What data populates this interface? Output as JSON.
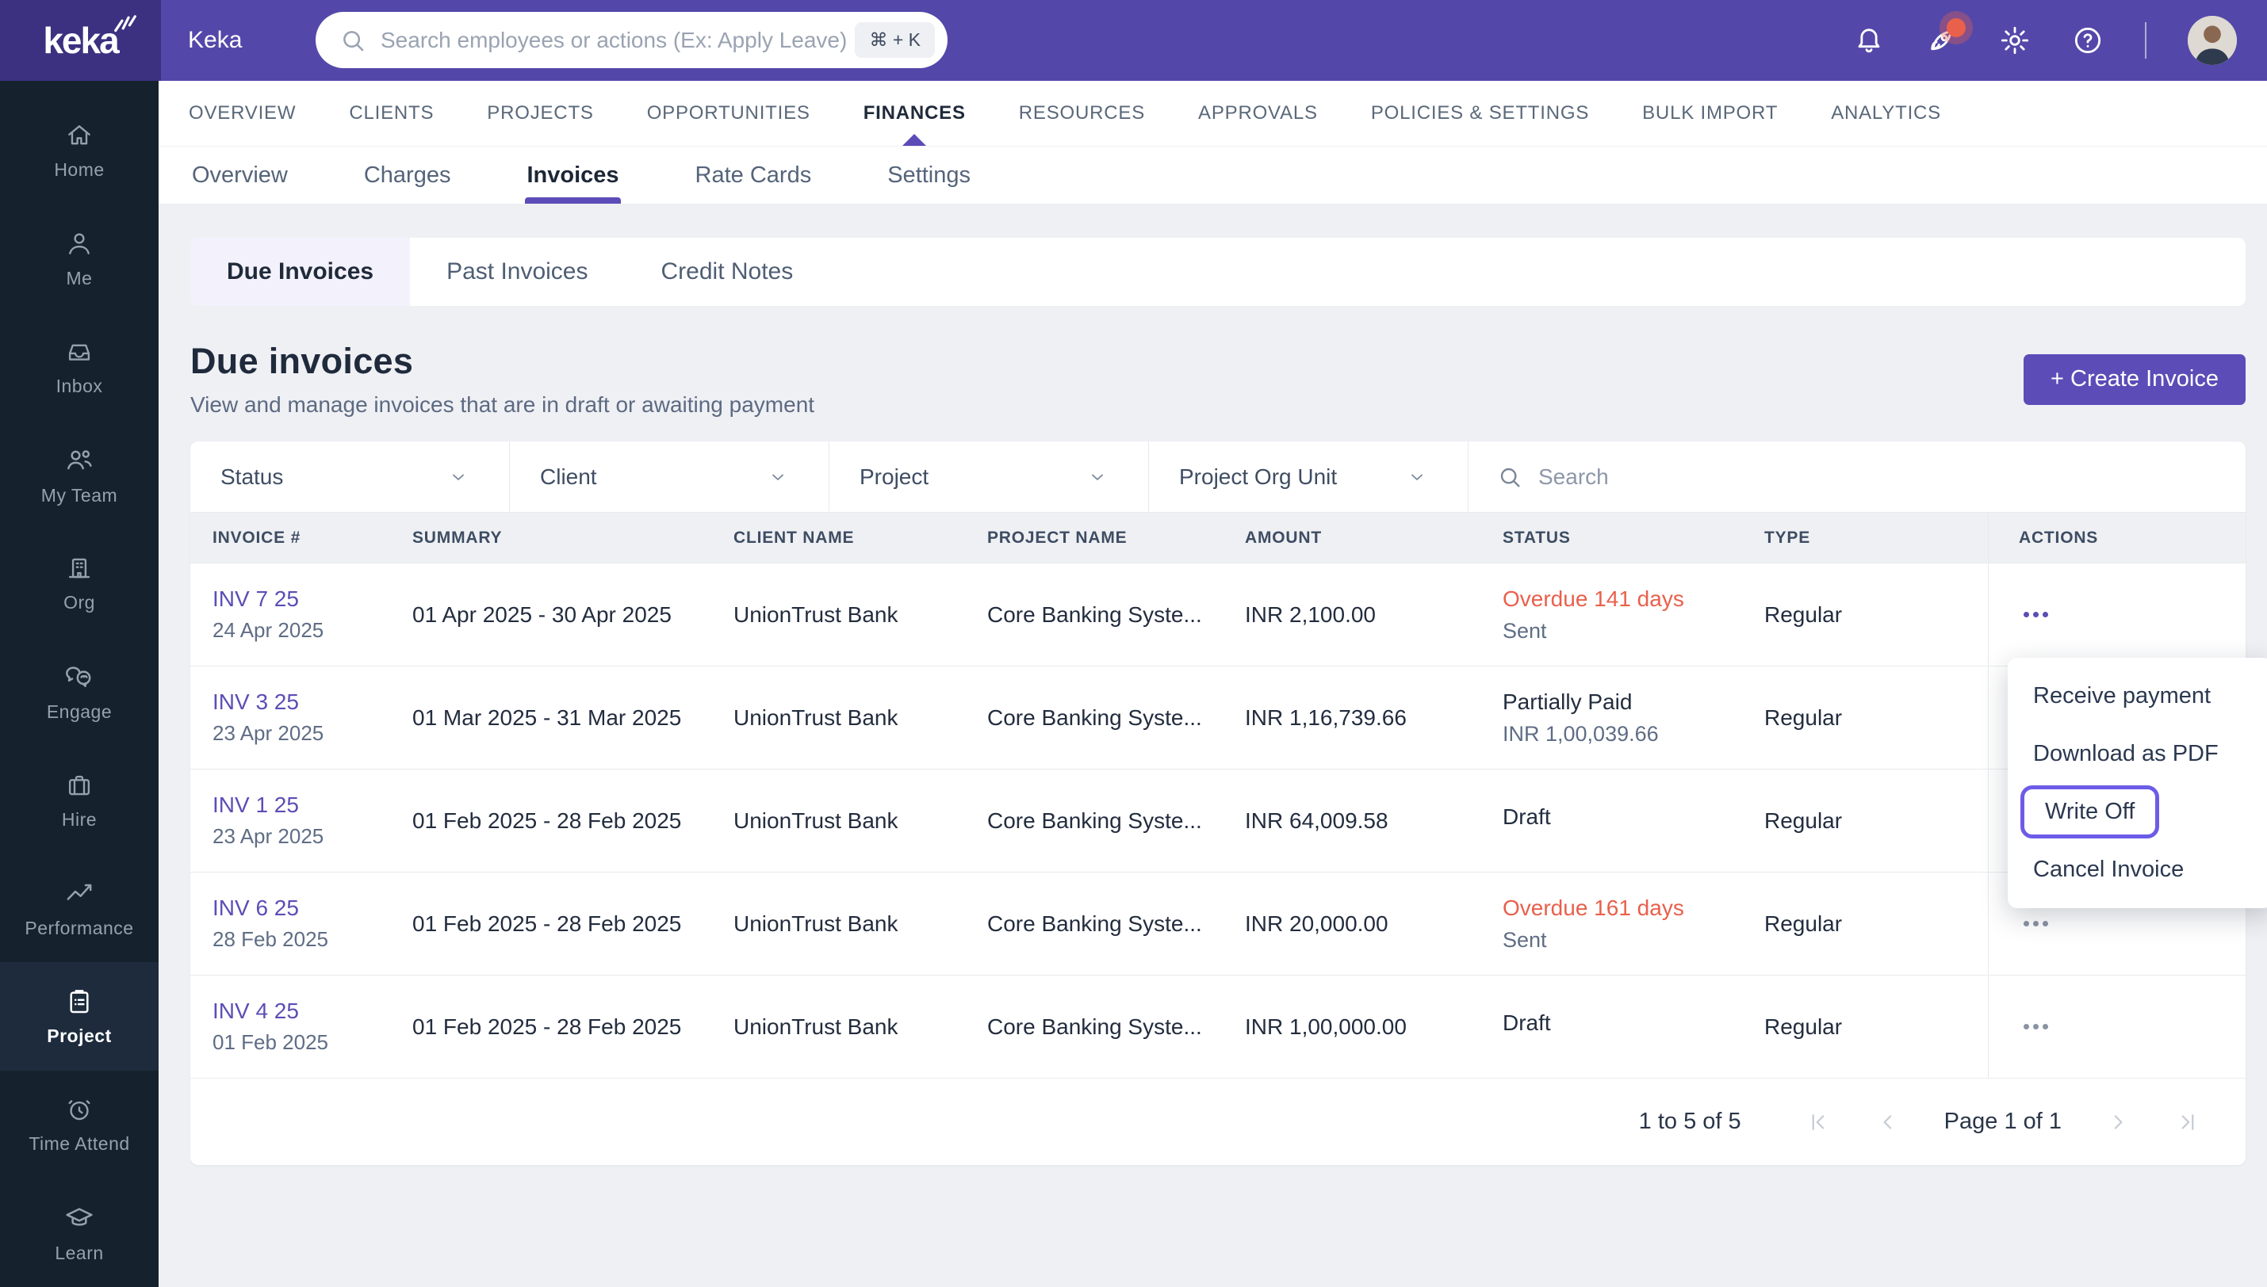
{
  "brand": {
    "logo_text": "keka",
    "app_label": "Keka"
  },
  "topbar": {
    "search_placeholder": "Search employees or actions (Ex: Apply Leave)",
    "shortcut": "⌘ + K",
    "icons": [
      "bell-icon",
      "rocket-icon",
      "gear-icon",
      "help-icon",
      "avatar"
    ]
  },
  "sidebar": {
    "items": [
      {
        "label": "Home",
        "icon": "home-icon"
      },
      {
        "label": "Me",
        "icon": "person-icon"
      },
      {
        "label": "Inbox",
        "icon": "inbox-icon"
      },
      {
        "label": "My Team",
        "icon": "team-icon"
      },
      {
        "label": "Org",
        "icon": "building-icon"
      },
      {
        "label": "Engage",
        "icon": "engage-icon"
      },
      {
        "label": "Hire",
        "icon": "briefcase-icon"
      },
      {
        "label": "Performance",
        "icon": "trend-icon"
      },
      {
        "label": "Project",
        "icon": "clipboard-icon",
        "active": true
      },
      {
        "label": "Time Attend",
        "icon": "alarm-icon"
      },
      {
        "label": "Learn",
        "icon": "grad-cap-icon"
      }
    ]
  },
  "primary_nav": {
    "items": [
      "OVERVIEW",
      "CLIENTS",
      "PROJECTS",
      "OPPORTUNITIES",
      "FINANCES",
      "RESOURCES",
      "APPROVALS",
      "POLICIES & SETTINGS",
      "BULK IMPORT",
      "ANALYTICS"
    ],
    "active": "FINANCES"
  },
  "secondary_nav": {
    "items": [
      "Overview",
      "Charges",
      "Invoices",
      "Rate Cards",
      "Settings"
    ],
    "active": "Invoices"
  },
  "tabs": {
    "items": [
      "Due Invoices",
      "Past Invoices",
      "Credit Notes"
    ],
    "active": "Due Invoices"
  },
  "page": {
    "title": "Due invoices",
    "subtitle": "View and manage invoices that are in draft or awaiting payment",
    "create_button": "+ Create Invoice"
  },
  "filters": {
    "status": "Status",
    "client": "Client",
    "project": "Project",
    "org_unit": "Project Org Unit",
    "search_placeholder": "Search"
  },
  "table": {
    "columns": [
      "INVOICE #",
      "SUMMARY",
      "CLIENT NAME",
      "PROJECT NAME",
      "AMOUNT",
      "STATUS",
      "TYPE",
      "ACTIONS"
    ],
    "rows": [
      {
        "invoice_no": "INV 7 25",
        "invoice_date": "24 Apr 2025",
        "summary": "01 Apr 2025 - 30 Apr 2025",
        "client": "UnionTrust Bank",
        "project": "Core Banking Syste...",
        "amount": "INR 2,100.00",
        "status_line1": "Overdue 141 days",
        "status_class": "status-red",
        "status_line2": "Sent",
        "type": "Regular"
      },
      {
        "invoice_no": "INV 3 25",
        "invoice_date": "23 Apr 2025",
        "summary": "01 Mar 2025 - 31 Mar 2025",
        "client": "UnionTrust Bank",
        "project": "Core Banking Syste...",
        "amount": "INR 1,16,739.66",
        "status_line1": "Partially Paid",
        "status_class": "status-dark",
        "status_line2": "INR 1,00,039.66",
        "type": "Regular"
      },
      {
        "invoice_no": "INV 1 25",
        "invoice_date": "23 Apr 2025",
        "summary": "01 Feb 2025 - 28 Feb 2025",
        "client": "UnionTrust Bank",
        "project": "Core Banking Syste...",
        "amount": "INR 64,009.58",
        "status_line1": "Draft",
        "status_class": "status-dark",
        "status_line2": "",
        "type": "Regular"
      },
      {
        "invoice_no": "INV 6 25",
        "invoice_date": "28 Feb 2025",
        "summary": "01 Feb 2025 - 28 Feb 2025",
        "client": "UnionTrust Bank",
        "project": "Core Banking Syste...",
        "amount": "INR 20,000.00",
        "status_line1": "Overdue 161 days",
        "status_class": "status-red",
        "status_line2": "Sent",
        "type": "Regular"
      },
      {
        "invoice_no": "INV 4 25",
        "invoice_date": "01 Feb 2025",
        "summary": "01 Feb 2025 - 28 Feb 2025",
        "client": "UnionTrust Bank",
        "project": "Core Banking Syste...",
        "amount": "INR 1,00,000.00",
        "status_line1": "Draft",
        "status_class": "status-dark",
        "status_line2": "",
        "type": "Regular"
      }
    ]
  },
  "context_menu": {
    "items": [
      "Receive payment",
      "Download as PDF",
      "Write Off",
      "Cancel Invoice"
    ],
    "highlighted": "Write Off"
  },
  "pagination": {
    "range": "1 to 5 of 5",
    "page": "Page 1 of 1"
  },
  "colors": {
    "accent": "#5b4cb8",
    "header": "#5348a9",
    "logo_bg": "#3b3180",
    "sidebar": "#15222e",
    "sidebar_active": "#1d2b3d",
    "red": "#e9604c",
    "tab_active_bg": "#f3f1fb",
    "menu_outline": "#6c5ce7"
  }
}
